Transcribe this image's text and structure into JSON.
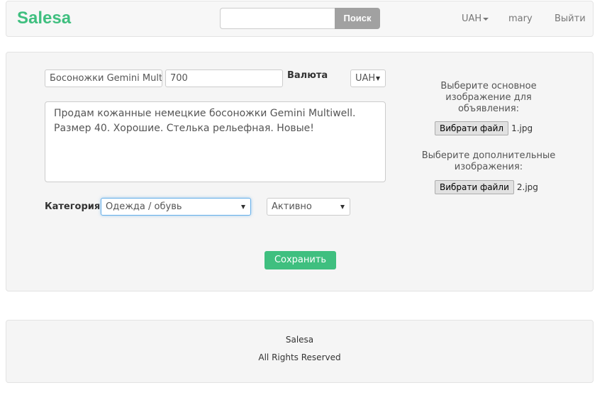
{
  "header": {
    "brand": "Salesa",
    "search": {
      "value": "",
      "placeholder": "",
      "button_label": "Поиск"
    },
    "currency_menu": "UAH",
    "user": "mary",
    "logout": "Выйти"
  },
  "form": {
    "title_value": "Босоножки Gemini Multiwell",
    "price_value": "700",
    "currency_label": "Валюта",
    "currency_selected": "UAH",
    "description_value": "Продам кожанные немецкие босоножки Gemini Multiwell. Размер 40. Хорошие. Стелька рельефная. Новые!",
    "category_label": "Категория:",
    "category_selected": "Одежда / обувь",
    "status_selected": "Активно",
    "save_label": "Сохранить"
  },
  "images": {
    "main_hint": "Выберите основное изображение для объявления:",
    "main_button": "Вибрати файл",
    "main_file": "1.jpg",
    "extra_hint": "Выберите дополнительные изображения:",
    "extra_button": "Вибрати файли",
    "extra_file": "2.jpg"
  },
  "footer": {
    "brand": "Salesa",
    "rights": "All Rights Reserved"
  },
  "colors": {
    "accent": "#3fbf7f",
    "search_button": "#a1a1a1",
    "focus_border": "#66afe9"
  }
}
